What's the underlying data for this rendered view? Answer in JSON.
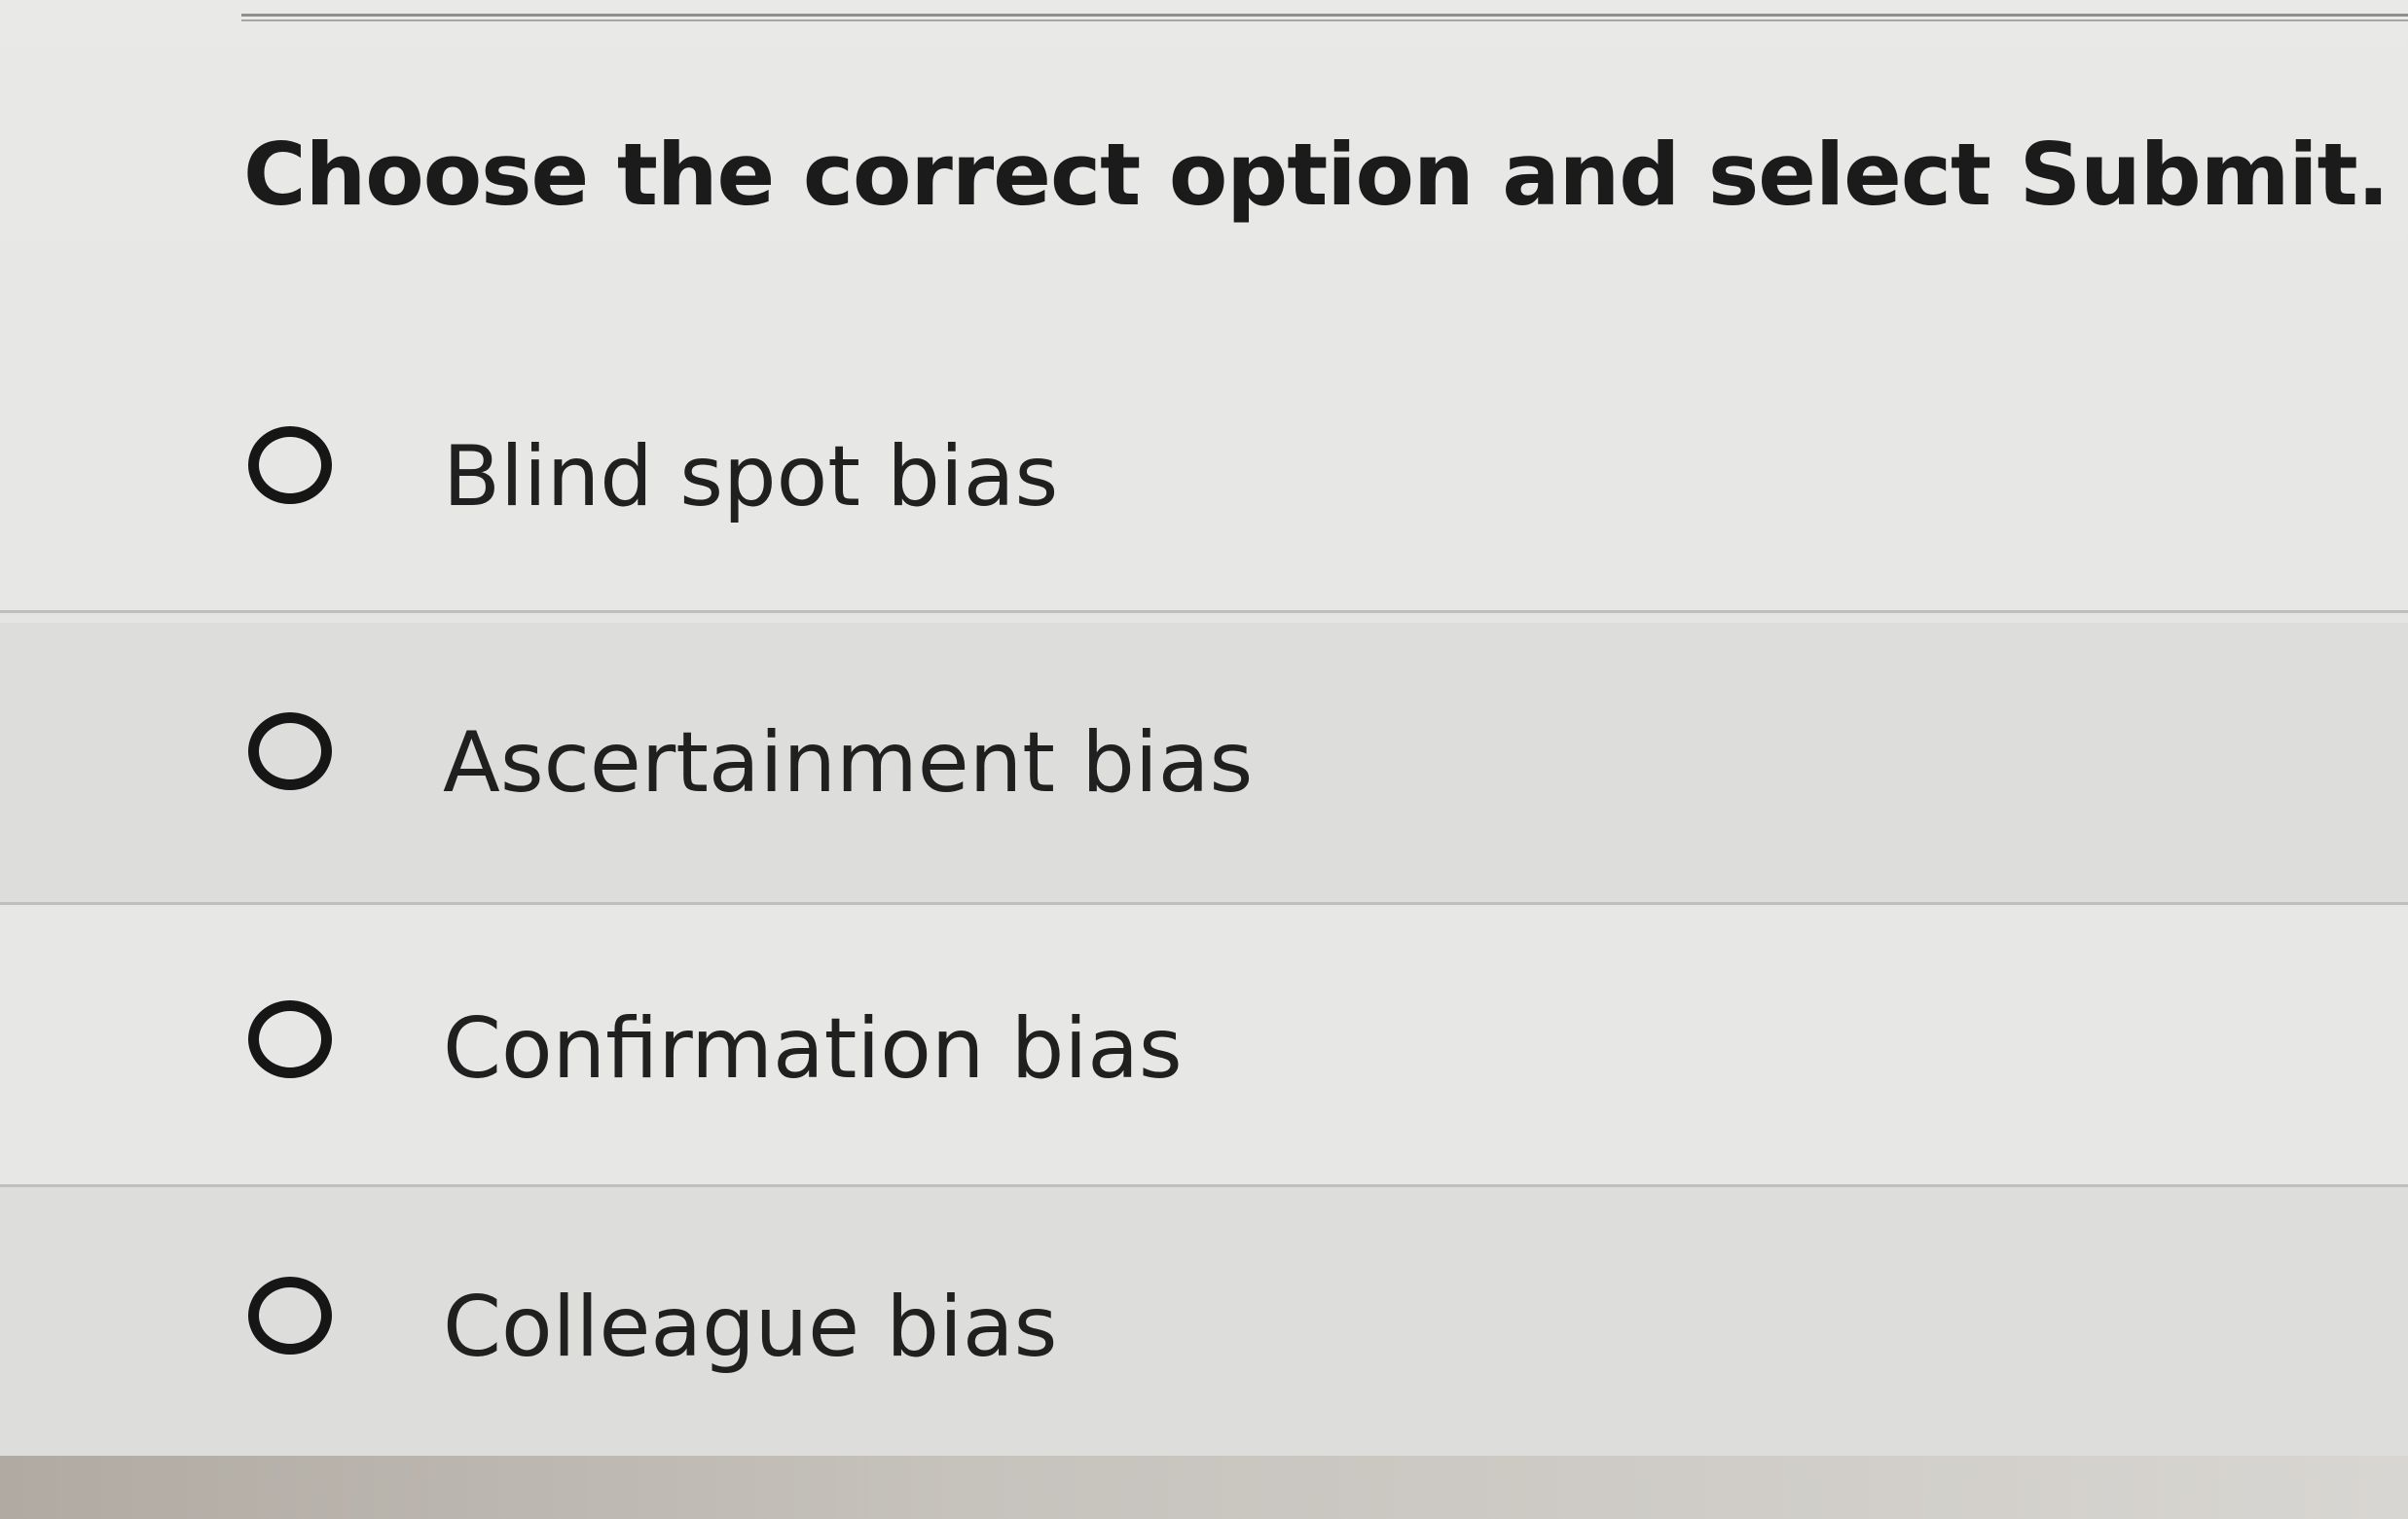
{
  "question": {
    "prompt": "Choose the correct option and select Submit."
  },
  "options": [
    {
      "label": "Blind spot bias",
      "selected": false
    },
    {
      "label": "Ascertainment bias",
      "selected": false
    },
    {
      "label": "Confirmation bias",
      "selected": false
    },
    {
      "label": "Colleague bias",
      "selected": false
    }
  ]
}
